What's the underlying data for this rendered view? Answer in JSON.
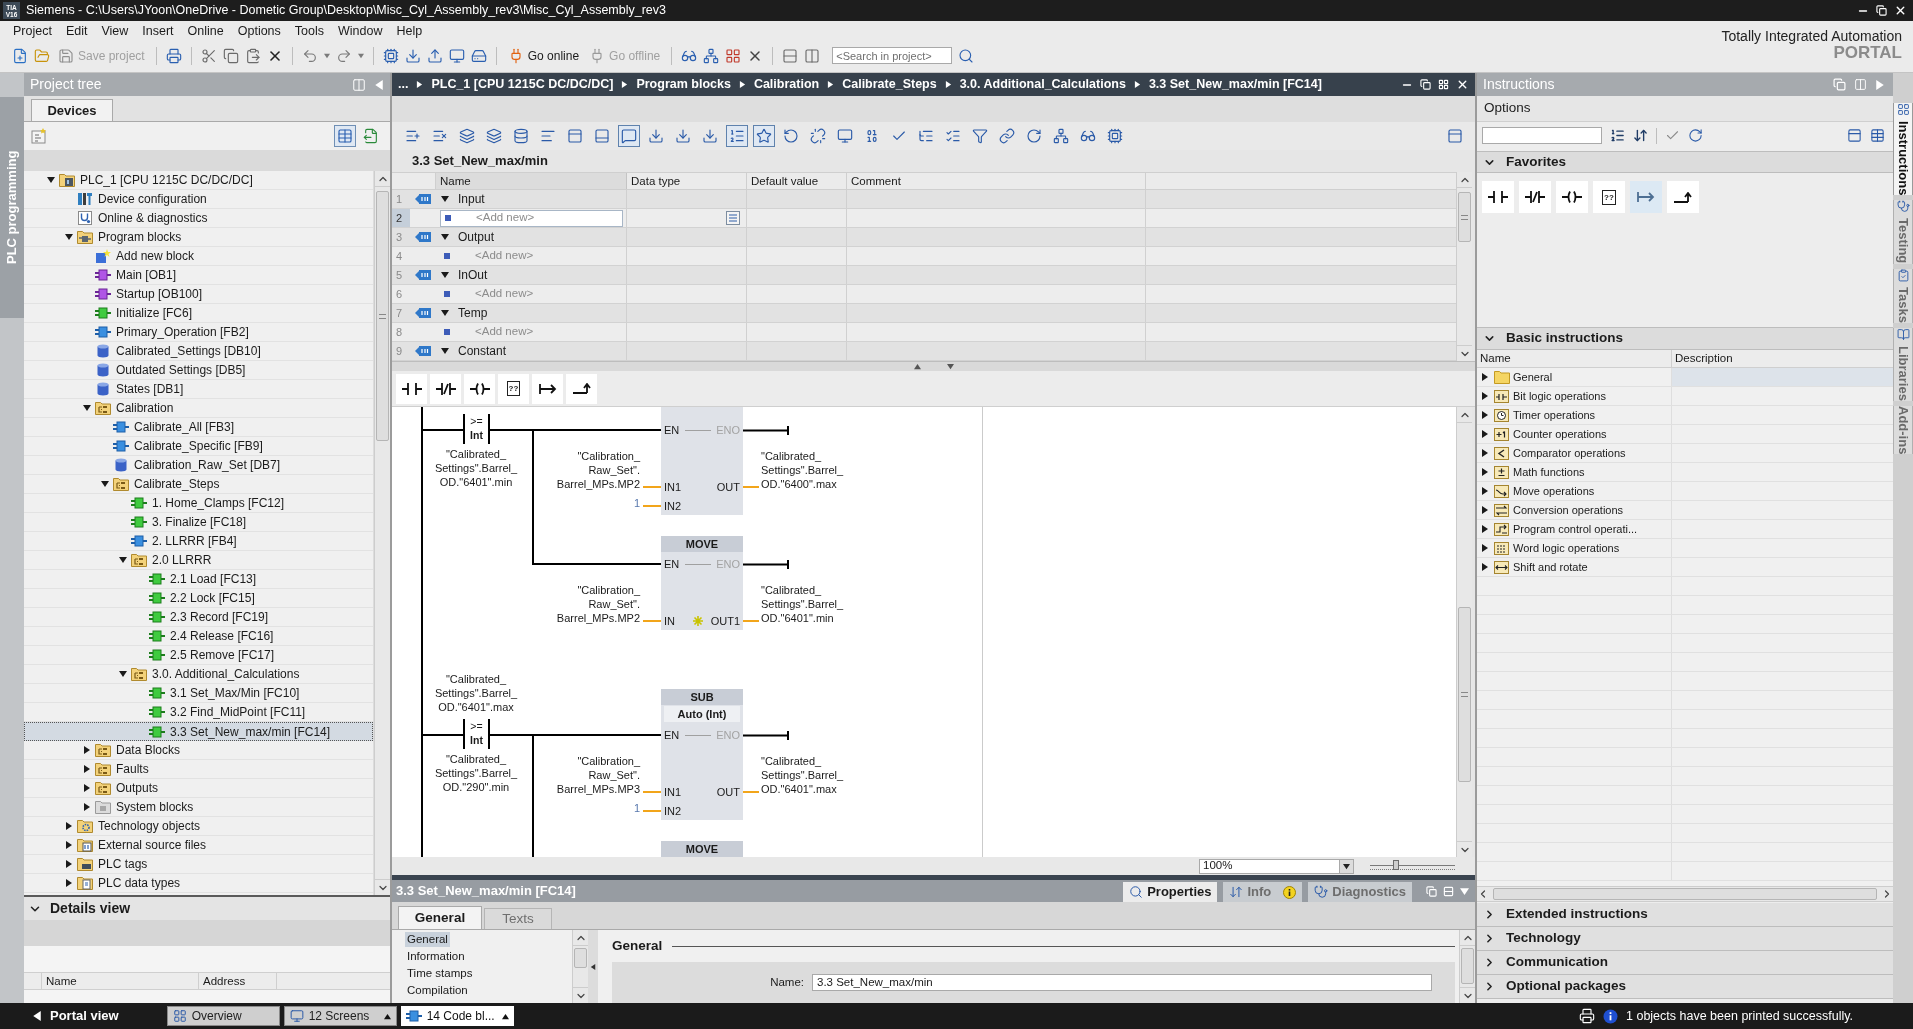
{
  "window": {
    "badge": [
      "TIA",
      "V16"
    ],
    "title": "Siemens - C:\\Users\\JYoon\\OneDrive - Dometic Group\\Desktop\\Misc_Cyl_Assembly_rev3\\Misc_Cyl_Assembly_rev3"
  },
  "menu": [
    "Project",
    "Edit",
    "View",
    "Insert",
    "Online",
    "Options",
    "Tools",
    "Window",
    "Help"
  ],
  "toolbar": {
    "save_project": {
      "label": "Save project",
      "disabled": true
    },
    "go_online": {
      "label": "Go online",
      "disabled": false
    },
    "go_offline": {
      "label": "Go offline",
      "disabled": true
    },
    "search": {
      "placeholder": "<Search in project>"
    }
  },
  "brand": {
    "line1": "Totally Integrated Automation",
    "line2": "PORTAL"
  },
  "side_tab_left": {
    "label": "PLC programming",
    "selected": true
  },
  "project_tree": {
    "title": "Project tree",
    "tabs": [
      {
        "label": "Devices",
        "selected": true
      }
    ],
    "view_buttons": [
      {
        "kind": "list",
        "pressed": true
      },
      {
        "kind": "export",
        "pressed": false
      }
    ],
    "items": [
      {
        "label": "PLC_1 [CPU 1215C DC/DC/DC]",
        "kind": "plc",
        "expanded": true,
        "selected": false,
        "children": [
          {
            "label": "Device configuration",
            "kind": "device",
            "selected": false
          },
          {
            "label": "Online & diagnostics",
            "kind": "diagnostics",
            "selected": false
          },
          {
            "label": "Program blocks",
            "kind": "blocks",
            "expanded": true,
            "selected": false,
            "children": [
              {
                "label": "Add new block",
                "kind": "add",
                "selected": false
              },
              {
                "label": "Main [OB1]",
                "kind": "ob",
                "selected": false
              },
              {
                "label": "Startup [OB100]",
                "kind": "ob",
                "selected": false
              },
              {
                "label": "Initialize [FC6]",
                "kind": "fc",
                "selected": false
              },
              {
                "label": "Primary_Operation [FB2]",
                "kind": "fb",
                "selected": false
              },
              {
                "label": "Calibrated_Settings [DB10]",
                "kind": "db",
                "selected": false
              },
              {
                "label": "Outdated Settings [DB5]",
                "kind": "db",
                "selected": false
              },
              {
                "label": "States [DB1]",
                "kind": "db",
                "selected": false
              },
              {
                "label": "Calibration",
                "kind": "group",
                "expanded": true,
                "selected": false,
                "children": [
                  {
                    "label": "Calibrate_All [FB3]",
                    "kind": "fb",
                    "selected": false
                  },
                  {
                    "label": "Calibrate_Specific [FB9]",
                    "kind": "fb",
                    "selected": false
                  },
                  {
                    "label": "Calibration_Raw_Set [DB7]",
                    "kind": "db",
                    "selected": false
                  },
                  {
                    "label": "Calibrate_Steps",
                    "kind": "group",
                    "expanded": true,
                    "selected": false,
                    "children": [
                      {
                        "label": "1. Home_Clamps [FC12]",
                        "kind": "fc",
                        "selected": false
                      },
                      {
                        "label": "3. Finalize [FC18]",
                        "kind": "fc",
                        "selected": false
                      },
                      {
                        "label": "2. LLRRR [FB4]",
                        "kind": "fb",
                        "selected": false
                      },
                      {
                        "label": "2.0 LLRRR",
                        "kind": "group",
                        "expanded": true,
                        "selected": false,
                        "children": [
                          {
                            "label": "2.1 Load [FC13]",
                            "kind": "fc",
                            "selected": false
                          },
                          {
                            "label": "2.2 Lock [FC15]",
                            "kind": "fc",
                            "selected": false
                          },
                          {
                            "label": "2.3 Record [FC19]",
                            "kind": "fc",
                            "selected": false
                          },
                          {
                            "label": "2.4 Release [FC16]",
                            "kind": "fc",
                            "selected": false
                          },
                          {
                            "label": "2.5 Remove [FC17]",
                            "kind": "fc",
                            "selected": false
                          }
                        ]
                      },
                      {
                        "label": "3.0. Additional_Calculations",
                        "kind": "group",
                        "expanded": true,
                        "selected": false,
                        "children": [
                          {
                            "label": "3.1 Set_Max/Min [FC10]",
                            "kind": "fc",
                            "selected": false
                          },
                          {
                            "label": "3.2 Find_MidPoint [FC11]",
                            "kind": "fc",
                            "selected": false
                          },
                          {
                            "label": "3.3 Set_New_max/min [FC14]",
                            "kind": "fc",
                            "selected": true
                          }
                        ]
                      }
                    ]
                  }
                ]
              },
              {
                "label": "Data Blocks",
                "kind": "group",
                "expanded": false,
                "selected": false
              },
              {
                "label": "Faults",
                "kind": "group",
                "expanded": false,
                "selected": false
              },
              {
                "label": "Outputs",
                "kind": "group",
                "expanded": false,
                "selected": false
              },
              {
                "label": "System blocks",
                "kind": "system",
                "expanded": false,
                "selected": false
              }
            ]
          },
          {
            "label": "Technology objects",
            "kind": "tech",
            "expanded": false,
            "selected": false
          },
          {
            "label": "External source files",
            "kind": "sources",
            "expanded": false,
            "selected": false
          },
          {
            "label": "PLC tags",
            "kind": "tags",
            "expanded": false,
            "selected": false
          },
          {
            "label": "PLC data types",
            "kind": "types",
            "expanded": false,
            "selected": false
          }
        ]
      }
    ]
  },
  "details_view": {
    "title": "Details view",
    "expanded": true,
    "columns": [
      "Name",
      "Address"
    ]
  },
  "editor": {
    "breadcrumb": [
      "...",
      "PLC_1 [CPU 1215C DC/DC/DC]",
      "Program blocks",
      "Calibration",
      "Calibrate_Steps",
      "3.0. Additional_Calculations",
      "3.3 Set_New_max/min [FC14]"
    ],
    "toolbar": [
      {
        "kind": "list-plus",
        "pressed": false
      },
      {
        "kind": "list-x",
        "pressed": false
      },
      {
        "kind": "layers",
        "pressed": false
      },
      {
        "kind": "layers",
        "pressed": false
      },
      {
        "kind": "database",
        "pressed": false
      },
      {
        "kind": "align-left",
        "pressed": false
      },
      {
        "kind": "panel-top",
        "pressed": false
      },
      {
        "kind": "panel-bottom",
        "pressed": false
      },
      {
        "kind": "comment",
        "pressed": true
      },
      {
        "kind": "download",
        "pressed": false
      },
      {
        "kind": "download",
        "pressed": false
      },
      {
        "kind": "download",
        "pressed": false
      },
      {
        "kind": "list-ordered",
        "pressed": true
      },
      {
        "kind": "star",
        "pressed": true
      },
      {
        "kind": "rotate-left",
        "pressed": false
      },
      {
        "kind": "unlink",
        "pressed": false
      },
      {
        "kind": "monitor",
        "pressed": false
      },
      {
        "kind": "binary",
        "pressed": false
      },
      {
        "kind": "check",
        "pressed": false
      },
      {
        "kind": "list-tree",
        "pressed": false
      },
      {
        "kind": "list-checks",
        "pressed": false
      },
      {
        "kind": "filter",
        "pressed": false
      },
      {
        "kind": "link",
        "pressed": false
      },
      {
        "kind": "rotate-right",
        "pressed": false
      },
      {
        "kind": "network",
        "pressed": false
      },
      {
        "kind": "glasses",
        "pressed": false
      },
      {
        "kind": "chip",
        "pressed": false
      }
    ],
    "block_title": "3.3 Set_New_max/min",
    "interface": {
      "columns": [
        "Name",
        "Data type",
        "Default value",
        "Comment"
      ],
      "rows": [
        {
          "number": "1",
          "kind": "section",
          "name": "Input",
          "expanded": true,
          "selected": false
        },
        {
          "number": "2",
          "kind": "add",
          "name": "<Add new>",
          "selected": true
        },
        {
          "number": "3",
          "kind": "section",
          "name": "Output",
          "expanded": true,
          "selected": false
        },
        {
          "number": "4",
          "kind": "add",
          "name": "<Add new>",
          "selected": false
        },
        {
          "number": "5",
          "kind": "section",
          "name": "InOut",
          "expanded": true,
          "selected": false
        },
        {
          "number": "6",
          "kind": "add",
          "name": "<Add new>",
          "selected": false
        },
        {
          "number": "7",
          "kind": "section",
          "name": "Temp",
          "expanded": true,
          "selected": false
        },
        {
          "number": "8",
          "kind": "add",
          "name": "<Add new>",
          "selected": false
        },
        {
          "number": "9",
          "kind": "section",
          "name": "Constant",
          "expanded": true,
          "selected": false
        }
      ]
    },
    "favorites": [
      {
        "kind": "contact"
      },
      {
        "kind": "negated"
      },
      {
        "kind": "coil"
      },
      {
        "kind": "box",
        "glyph": "??"
      },
      {
        "kind": "branch-open"
      },
      {
        "kind": "branch-close"
      }
    ],
    "networks": [
      {
        "contact": {
          "operator": ">=",
          "type": "Int",
          "operand_below": [
            "\"Calibrated_",
            "Settings\".Barrel_",
            "OD.\"6401\".min"
          ]
        },
        "boxes": [
          {
            "en": "EN",
            "eno": "ENO",
            "inputs": [
              {
                "pin": "IN1",
                "kind": "tag",
                "operand": [
                  "\"Calibration_",
                  "Raw_Set\".",
                  "Barrel_MPs.MP2"
                ]
              },
              {
                "pin": "IN2",
                "kind": "constant",
                "operand": [
                  "1"
                ]
              }
            ],
            "outputs": [
              {
                "pin": "OUT",
                "operand": [
                  "\"Calibrated_",
                  "Settings\".Barrel_",
                  "OD.\"6400\".max"
                ]
              }
            ]
          },
          {
            "title": "MOVE",
            "en": "EN",
            "eno": "ENO",
            "inputs": [
              {
                "pin": "IN",
                "kind": "tag",
                "operand": [
                  "\"Calibration_",
                  "Raw_Set\".",
                  "Barrel_MPs.MP2"
                ]
              }
            ],
            "outputs": [
              {
                "pin": "OUT1",
                "add_pin": true,
                "operand": [
                  "\"Calibrated_",
                  "Settings\".Barrel_",
                  "OD.\"6401\".min"
                ]
              }
            ]
          }
        ]
      },
      {
        "contact": {
          "operand_above": [
            "\"Calibrated_",
            "Settings\".Barrel_",
            "OD.\"6401\".max"
          ],
          "operator": ">=",
          "type": "Int",
          "operand_below": [
            "\"Calibrated_",
            "Settings\".Barrel_",
            "OD.\"290\".min"
          ]
        },
        "boxes": [
          {
            "title": "SUB",
            "subtitle": "Auto (Int)",
            "en": "EN",
            "eno": "ENO",
            "inputs": [
              {
                "pin": "IN1",
                "kind": "tag",
                "operand": [
                  "\"Calibration_",
                  "Raw_Set\".",
                  "Barrel_MPs.MP3"
                ]
              },
              {
                "pin": "IN2",
                "kind": "constant",
                "operand": [
                  "1"
                ]
              }
            ],
            "outputs": [
              {
                "pin": "OUT",
                "operand": [
                  "\"Calibrated_",
                  "Settings\".Barrel_",
                  "OD.\"6401\".max"
                ]
              }
            ]
          },
          {
            "title": "MOVE"
          }
        ]
      }
    ],
    "zoom": {
      "value": "100%",
      "level": 0.3
    }
  },
  "properties": {
    "title": "3.3 Set_New_max/min [FC14]",
    "tabs": [
      {
        "label": "Properties",
        "kind": "properties",
        "selected": true,
        "badge": false
      },
      {
        "label": "Info",
        "kind": "info",
        "selected": false,
        "badge": true
      },
      {
        "label": "Diagnostics",
        "kind": "diagnostics",
        "selected": false,
        "badge": false
      }
    ],
    "subtabs": [
      {
        "label": "General",
        "selected": true
      },
      {
        "label": "Texts",
        "selected": false
      }
    ],
    "nav": [
      {
        "label": "General",
        "selected": true
      },
      {
        "label": "Information",
        "selected": false
      },
      {
        "label": "Time stamps",
        "selected": false
      },
      {
        "label": "Compilation",
        "selected": false
      }
    ],
    "section_title": "General",
    "fields": [
      {
        "label": "Name:",
        "value": "3.3 Set_New_max/min"
      }
    ]
  },
  "instructions": {
    "title": "Instructions",
    "options": "Options",
    "favorites": {
      "label": "Favorites",
      "expanded": true,
      "items": [
        {
          "kind": "contact",
          "highlighted": false
        },
        {
          "kind": "negated",
          "highlighted": false
        },
        {
          "kind": "coil",
          "highlighted": false
        },
        {
          "kind": "box",
          "glyph": "??",
          "highlighted": false
        },
        {
          "kind": "branch-open",
          "highlighted": true
        },
        {
          "kind": "branch-close",
          "highlighted": false
        }
      ]
    },
    "basic": {
      "label": "Basic instructions",
      "expanded": true,
      "columns": [
        "Name",
        "Description"
      ],
      "items": [
        {
          "label": "General",
          "kind": "folder",
          "expanded": false,
          "selected": true
        },
        {
          "label": "Bit logic operations",
          "kind": "bit",
          "expanded": false,
          "selected": false
        },
        {
          "label": "Timer operations",
          "kind": "timer",
          "expanded": false,
          "selected": false
        },
        {
          "label": "Counter operations",
          "kind": "counter",
          "expanded": false,
          "selected": false
        },
        {
          "label": "Comparator operations",
          "kind": "compare",
          "expanded": false,
          "selected": false
        },
        {
          "label": "Math functions",
          "kind": "math",
          "expanded": false,
          "selected": false
        },
        {
          "label": "Move operations",
          "kind": "move",
          "expanded": false,
          "selected": false
        },
        {
          "label": "Conversion operations",
          "kind": "convert",
          "expanded": false,
          "selected": false
        },
        {
          "label": "Program control operati...",
          "kind": "control",
          "expanded": false,
          "selected": false
        },
        {
          "label": "Word logic operations",
          "kind": "word",
          "expanded": false,
          "selected": false
        },
        {
          "label": "Shift and rotate",
          "kind": "shift",
          "expanded": false,
          "selected": false
        }
      ]
    },
    "more_sections": [
      {
        "label": "Extended instructions",
        "expanded": false
      },
      {
        "label": "Technology",
        "expanded": false
      },
      {
        "label": "Communication",
        "expanded": false
      },
      {
        "label": "Optional packages",
        "expanded": false
      }
    ]
  },
  "side_tabs": [
    {
      "label": "Instructions",
      "selected": true
    },
    {
      "label": "Testing",
      "selected": false
    },
    {
      "label": "Tasks",
      "selected": false
    },
    {
      "label": "Libraries",
      "selected": false
    },
    {
      "label": "Add-ins",
      "selected": false
    }
  ],
  "status_bar": {
    "portal_view": "Portal view",
    "tabs": [
      {
        "label": "Overview",
        "kind": "overview",
        "grouped": false,
        "selected": false
      },
      {
        "label": "12 Screens",
        "kind": "screens",
        "grouped": true,
        "selected": false
      },
      {
        "label": "14 Code bl...",
        "kind": "code",
        "grouped": true,
        "selected": true
      }
    ],
    "message": "1 objects have been printed successfully."
  }
}
